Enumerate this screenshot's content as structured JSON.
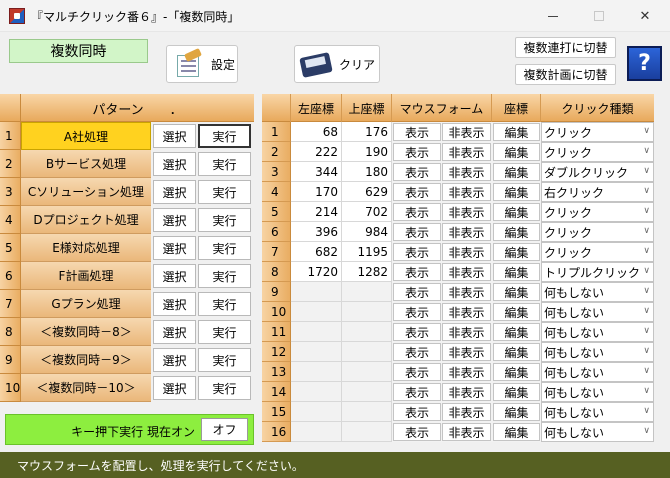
{
  "window": {
    "title": "『マルチクリック番６』-「複数同時」"
  },
  "toolbar": {
    "mode_label": "複数同時",
    "settings_label": "設定",
    "clear_label": "クリア",
    "switch_serial": "複数連打に切替",
    "switch_plan": "複数計画に切替",
    "help": "?"
  },
  "patterns": {
    "header": "パターン　　．",
    "select_label": "選択",
    "run_label": "実行",
    "rows": [
      {
        "num": "1",
        "name": "A社処理"
      },
      {
        "num": "2",
        "name": "Bサービス処理"
      },
      {
        "num": "3",
        "name": "Cソリューション処理"
      },
      {
        "num": "4",
        "name": "Dプロジェクト処理"
      },
      {
        "num": "5",
        "name": "E様対応処理"
      },
      {
        "num": "6",
        "name": "F計画処理"
      },
      {
        "num": "7",
        "name": "Gプラン処理"
      },
      {
        "num": "8",
        "name": "＜複数同時－8＞"
      },
      {
        "num": "9",
        "name": "＜複数同時－9＞"
      },
      {
        "num": "10",
        "name": "＜複数同時－10＞"
      }
    ],
    "active_index": 0
  },
  "key_bar": {
    "text": "キー押下実行 現在オン",
    "toggle": "オフ"
  },
  "coords": {
    "headers": {
      "x": "左座標",
      "y": "上座標",
      "mouse_form": "マウスフォーム",
      "coord": "座標",
      "click_type": "クリック種類"
    },
    "show_label": "表示",
    "hide_label": "非表示",
    "edit_label": "編集",
    "rows": [
      {
        "n": "1",
        "x": "68",
        "y": "176",
        "type": "クリック"
      },
      {
        "n": "2",
        "x": "222",
        "y": "190",
        "type": "クリック"
      },
      {
        "n": "3",
        "x": "344",
        "y": "180",
        "type": "ダブルクリック"
      },
      {
        "n": "4",
        "x": "170",
        "y": "629",
        "type": "右クリック"
      },
      {
        "n": "5",
        "x": "214",
        "y": "702",
        "type": "クリック"
      },
      {
        "n": "6",
        "x": "396",
        "y": "984",
        "type": "クリック"
      },
      {
        "n": "7",
        "x": "682",
        "y": "1195",
        "type": "クリック"
      },
      {
        "n": "8",
        "x": "1720",
        "y": "1282",
        "type": "トリプルクリック"
      },
      {
        "n": "9",
        "x": "",
        "y": "",
        "type": "何もしない"
      },
      {
        "n": "10",
        "x": "",
        "y": "",
        "type": "何もしない"
      },
      {
        "n": "11",
        "x": "",
        "y": "",
        "type": "何もしない"
      },
      {
        "n": "12",
        "x": "",
        "y": "",
        "type": "何もしない"
      },
      {
        "n": "13",
        "x": "",
        "y": "",
        "type": "何もしない"
      },
      {
        "n": "14",
        "x": "",
        "y": "",
        "type": "何もしない"
      },
      {
        "n": "15",
        "x": "",
        "y": "",
        "type": "何もしない"
      },
      {
        "n": "16",
        "x": "",
        "y": "",
        "type": "何もしない"
      }
    ]
  },
  "status": {
    "message": "マウスフォームを配置し、処理を実行してください。"
  }
}
